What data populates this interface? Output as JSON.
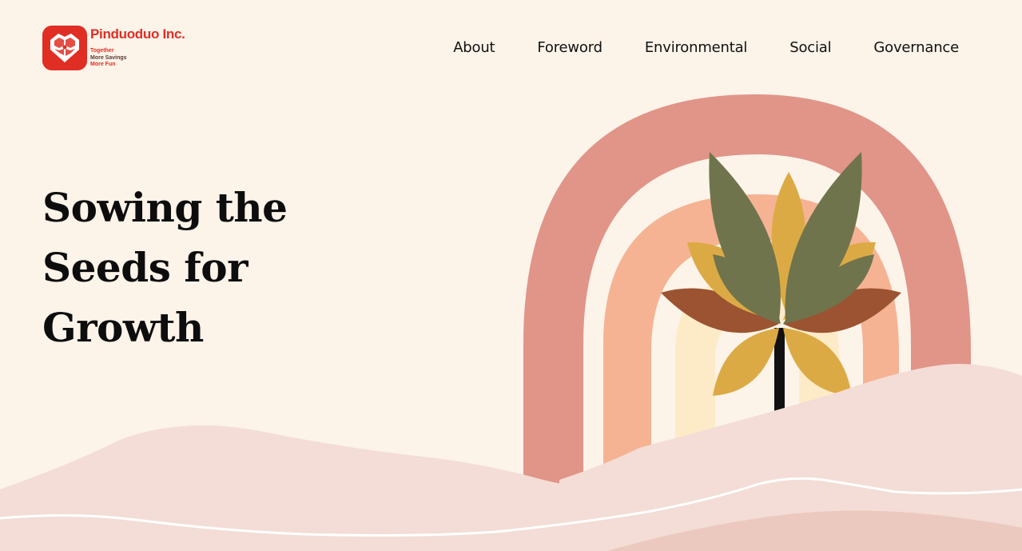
{
  "brand": {
    "name": "Pinduoduo Inc.",
    "tagline": [
      "Together",
      "More Savings",
      "More Fun"
    ],
    "color": "#e02e24"
  },
  "nav": {
    "items": [
      {
        "label": "About"
      },
      {
        "label": "Foreword"
      },
      {
        "label": "Environmental"
      },
      {
        "label": "Social"
      },
      {
        "label": "Governance"
      }
    ]
  },
  "hero": {
    "title_lines": [
      "Sowing the",
      "Seeds for",
      "Growth"
    ]
  },
  "colors": {
    "background": "#fcf3e9",
    "rainbow_outer": "#e19488",
    "rainbow_middle": "#f5b393",
    "rainbow_inner": "#fdebc8",
    "leaf_olive": "#6f744c",
    "leaf_gold": "#dcaa44",
    "leaf_rust": "#9b5331",
    "hills_light": "#f3ddd6",
    "hills_dark": "#ecc9bf"
  }
}
